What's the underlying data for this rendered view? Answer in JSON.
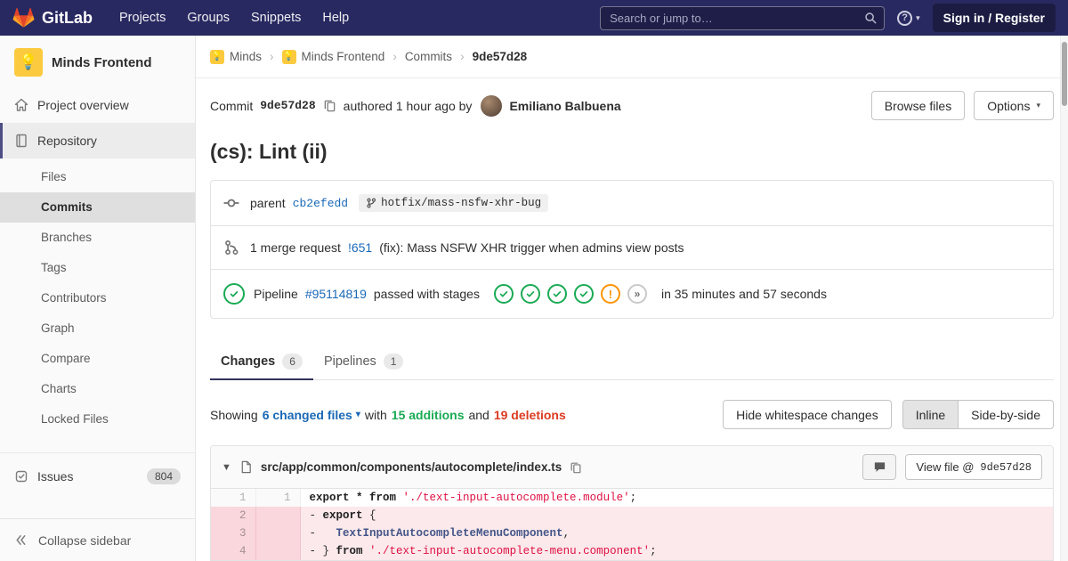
{
  "colors": {
    "navbar_bg": "#292961",
    "link_blue": "#1b69b6",
    "success_green": "#1aaa55",
    "danger_red": "#db3b21",
    "warning_orange": "#fc9403"
  },
  "navbar": {
    "brand": "GitLab",
    "links": [
      "Projects",
      "Groups",
      "Snippets",
      "Help"
    ],
    "search_placeholder": "Search or jump to…",
    "sign_in_label": "Sign in / Register"
  },
  "sidebar": {
    "project_name": "Minds Frontend",
    "project_overview_label": "Project overview",
    "repository_label": "Repository",
    "repo_items": [
      {
        "label": "Files",
        "active": false
      },
      {
        "label": "Commits",
        "active": true
      },
      {
        "label": "Branches",
        "active": false
      },
      {
        "label": "Tags",
        "active": false
      },
      {
        "label": "Contributors",
        "active": false
      },
      {
        "label": "Graph",
        "active": false
      },
      {
        "label": "Compare",
        "active": false
      },
      {
        "label": "Charts",
        "active": false
      },
      {
        "label": "Locked Files",
        "active": false
      }
    ],
    "issues_label": "Issues",
    "issues_count": "804",
    "collapse_label": "Collapse sidebar"
  },
  "breadcrumb": {
    "avatar_glyph": "💡",
    "items": [
      {
        "label": "Minds",
        "avatar": true,
        "current": false
      },
      {
        "label": "Minds Frontend",
        "avatar": true,
        "current": false
      },
      {
        "label": "Commits",
        "avatar": false,
        "current": false
      },
      {
        "label": "9de57d28",
        "avatar": false,
        "current": true
      }
    ]
  },
  "commit": {
    "label": "Commit",
    "sha": "9de57d28",
    "authored_text": "authored 1 hour ago by",
    "author_name": "Emiliano Balbuena",
    "browse_files_label": "Browse files",
    "options_label": "Options",
    "title": "(cs): Lint (ii)",
    "parent_label": "parent",
    "parent_sha": "cb2efedd",
    "branch_name": "hotfix/mass-nsfw-xhr-bug",
    "mr_prefix": "1 merge request",
    "mr_id": "!651",
    "mr_title": "(fix): Mass NSFW XHR trigger when admins view posts",
    "pipeline_label": "Pipeline",
    "pipeline_id": "#95114819",
    "pipeline_status": "passed with stages",
    "pipeline_stages": [
      "passed",
      "passed",
      "passed",
      "passed",
      "warning",
      "more"
    ],
    "pipeline_duration": "in 35 minutes and 57 seconds"
  },
  "tabs": [
    {
      "label": "Changes",
      "count": "6",
      "active": true
    },
    {
      "label": "Pipelines",
      "count": "1",
      "active": false
    }
  ],
  "diff_summary": {
    "showing_label": "Showing",
    "files_dropdown_label": "6 changed files",
    "with_label": "with",
    "additions_label": "15 additions",
    "and_label": "and",
    "deletions_label": "19 deletions",
    "hide_whitespace_label": "Hide whitespace changes",
    "inline_label": "Inline",
    "side_by_side_label": "Side-by-side"
  },
  "diff_file": {
    "path": "src/app/common/components/autocomplete/index.ts",
    "view_file_label": "View file @",
    "view_file_sha": "9de57d28",
    "lines": [
      {
        "old": "1",
        "new": "1",
        "type": "context",
        "segments": [
          {
            "t": "export * from ",
            "c": "k"
          },
          {
            "t": "'./text-input-autocomplete.module'",
            "c": "s"
          },
          {
            "t": ";",
            "c": "p"
          }
        ]
      },
      {
        "old": "2",
        "new": "",
        "type": "removed",
        "segments": [
          {
            "t": "- ",
            "c": "p"
          },
          {
            "t": "export",
            "c": "k"
          },
          {
            "t": " {",
            "c": "p"
          }
        ]
      },
      {
        "old": "3",
        "new": "",
        "type": "removed",
        "segments": [
          {
            "t": "-   ",
            "c": "p"
          },
          {
            "t": "TextInputAutocompleteMenuComponent",
            "c": "i"
          },
          {
            "t": ",",
            "c": "p"
          }
        ]
      },
      {
        "old": "4",
        "new": "",
        "type": "removed",
        "segments": [
          {
            "t": "- } ",
            "c": "p"
          },
          {
            "t": "from",
            "c": "k"
          },
          {
            "t": " ",
            "c": "p"
          },
          {
            "t": "'./text-input-autocomplete-menu.component'",
            "c": "s"
          },
          {
            "t": ";",
            "c": "p"
          }
        ]
      }
    ]
  }
}
